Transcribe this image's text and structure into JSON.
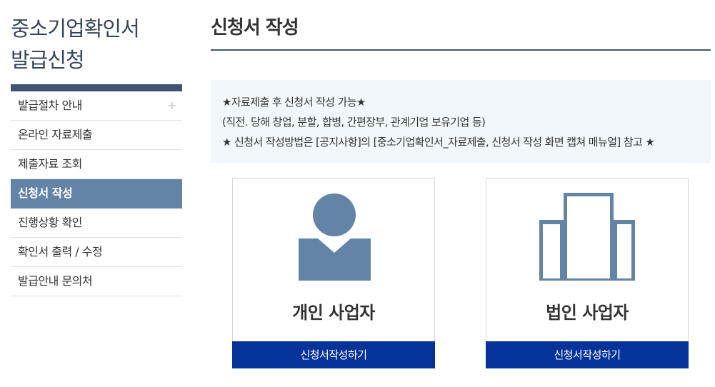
{
  "sidebar": {
    "title_line1": "중소기업확인서",
    "title_line2": "발급신청",
    "items": [
      {
        "label": "발급절차 안내",
        "plus": "+"
      },
      {
        "label": "온라인 자료제출"
      },
      {
        "label": "제출자료 조회"
      },
      {
        "label": "신청서 작성",
        "active": true
      },
      {
        "label": "진행상황 확인"
      },
      {
        "label": "확인서 출력 / 수정"
      },
      {
        "label": "발급안내 문의처"
      }
    ]
  },
  "main": {
    "title": "신청서 작성",
    "notice": {
      "line1": "★자료제출 후 신청서 작성 가능★",
      "line2": "(직전. 당해 창업, 분할, 합병, 간편장부, 관계기업 보유기업 등)",
      "line3": "★ 신청서 작성방법은 [공지사항]의 [중소기업확인서_자료제출, 신청서 작성 화면 캡쳐 매뉴얼] 참고 ★"
    },
    "cards": [
      {
        "label": "개인 사업자",
        "icon": "person-icon",
        "button": "신청서작성하기"
      },
      {
        "label": "법인 사업자",
        "icon": "building-icon",
        "button": "신청서작성하기"
      }
    ]
  },
  "colors": {
    "sidebar_active": "#6384a6",
    "sidebar_bar": "#3f5470",
    "notice_bg": "#f1f7fa",
    "icon": "#6384a6",
    "button": "#063399"
  }
}
